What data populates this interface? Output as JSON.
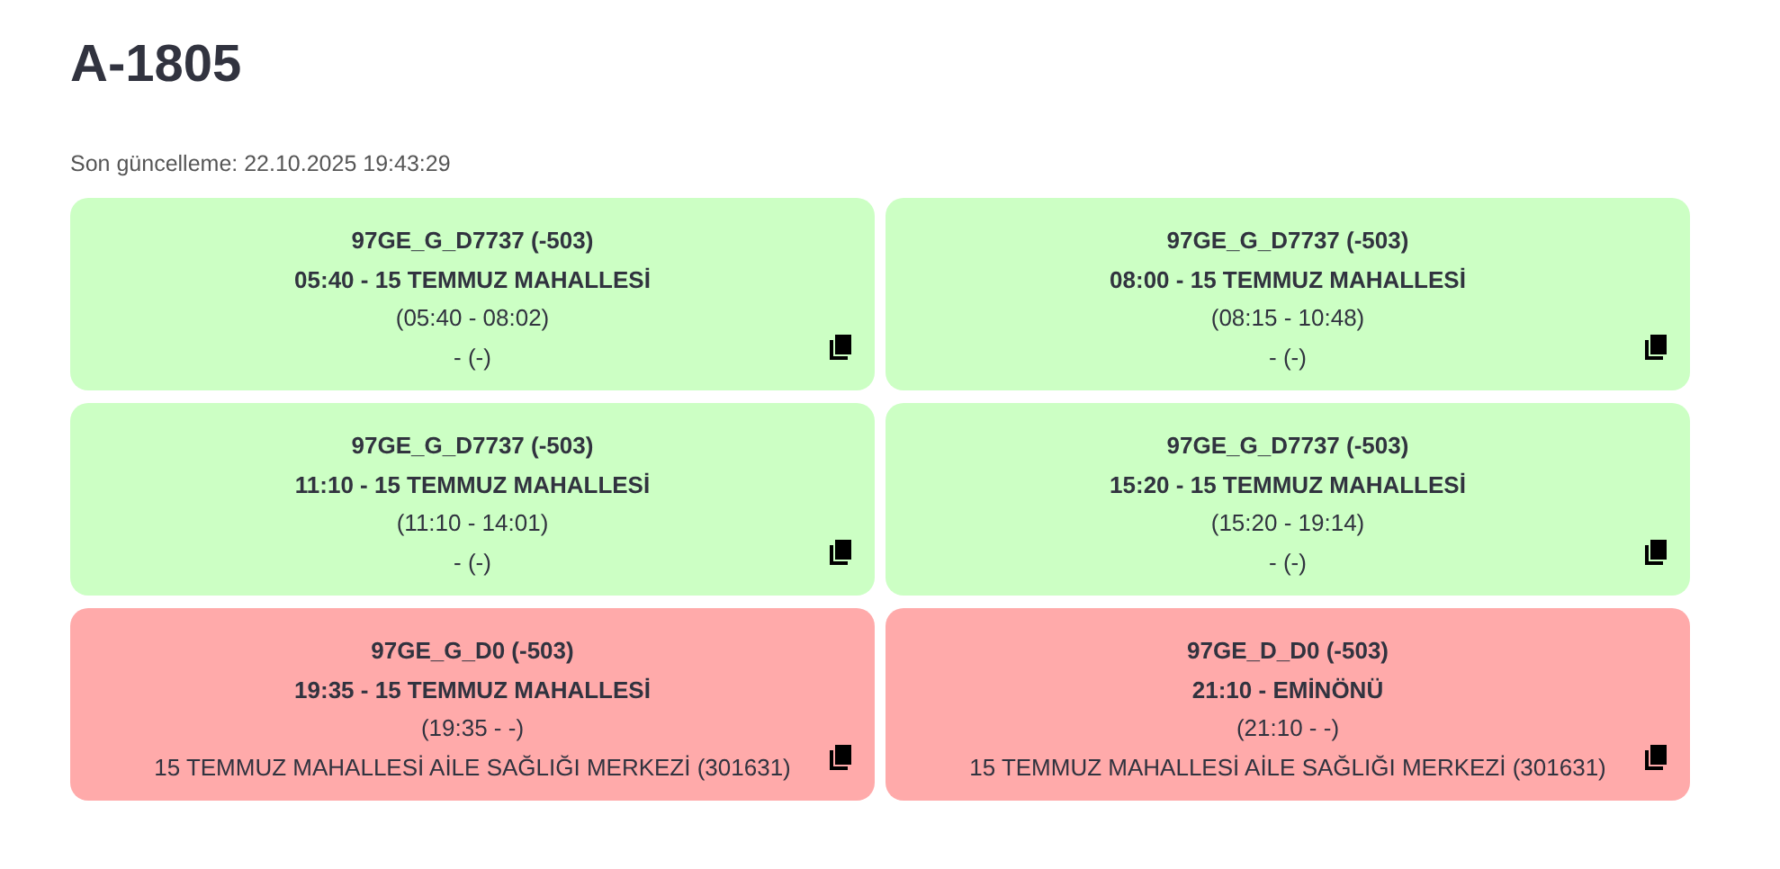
{
  "title": "A-1805",
  "last_update": "Son güncelleme: 22.10.2025 19:43:29",
  "cards": [
    {
      "color": "#ccffc4",
      "line_1": "97GE_G_D7737 (-503)",
      "line_2": "05:40 - 15 TEMMUZ MAHALLESİ",
      "line_3": "(05:40 - 08:02)",
      "line_4": "- (-)"
    },
    {
      "color": "#ccffc4",
      "line_1": "97GE_G_D7737 (-503)",
      "line_2": "08:00 - 15 TEMMUZ MAHALLESİ",
      "line_3": "(08:15 - 10:48)",
      "line_4": "- (-)"
    },
    {
      "color": "#ccffc4",
      "line_1": "97GE_G_D7737 (-503)",
      "line_2": "11:10 - 15 TEMMUZ MAHALLESİ",
      "line_3": "(11:10 - 14:01)",
      "line_4": "- (-)"
    },
    {
      "color": "#ccffc4",
      "line_1": "97GE_G_D7737 (-503)",
      "line_2": "15:20 - 15 TEMMUZ MAHALLESİ",
      "line_3": "(15:20 - 19:14)",
      "line_4": "- (-)"
    },
    {
      "color": "#ffaaaa",
      "line_1": "97GE_G_D0 (-503)",
      "line_2": "19:35 - 15 TEMMUZ MAHALLESİ",
      "line_3": "(19:35 - -)",
      "line_4": "15 TEMMUZ MAHALLESİ AİLE SAĞLIĞI MERKEZİ (301631)"
    },
    {
      "color": "#ffaaaa",
      "line_1": "97GE_D_D0 (-503)",
      "line_2": "21:10 - EMİNÖNÜ",
      "line_3": "(21:10 - -)",
      "line_4": "15 TEMMUZ MAHALLESİ AİLE SAĞLIĞI MERKEZİ (301631)"
    }
  ]
}
